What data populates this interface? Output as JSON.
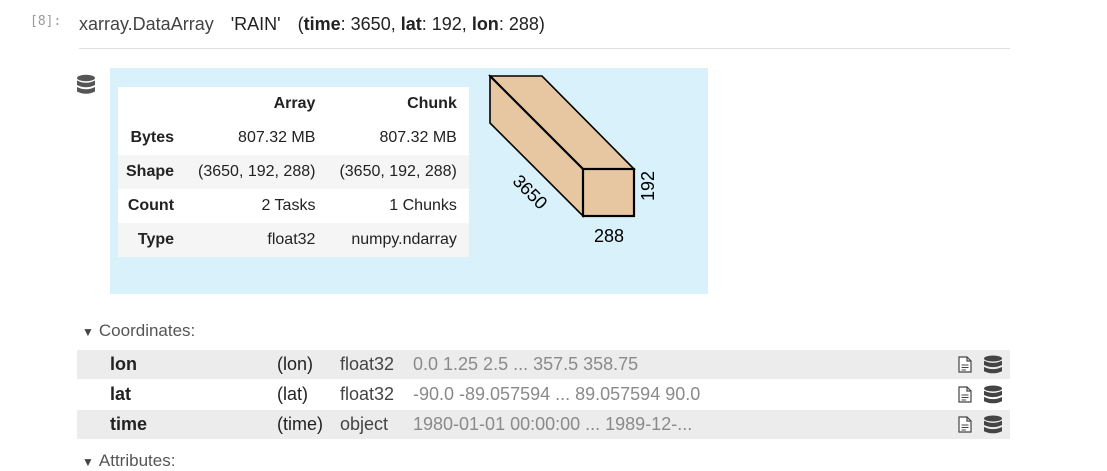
{
  "cell": {
    "prompt": "[8]:"
  },
  "header": {
    "class_name": "xarray.DataArray",
    "var_name": "'RAIN'",
    "dim_open": "(",
    "dims": [
      {
        "name": "time",
        "sep": ": ",
        "size": "3650",
        "trail": ", "
      },
      {
        "name": "lat",
        "sep": ": ",
        "size": "192",
        "trail": ", "
      },
      {
        "name": "lon",
        "sep": ": ",
        "size": "288",
        "trail": ")"
      }
    ]
  },
  "chunk_table": {
    "headers": [
      "",
      "Array",
      "Chunk"
    ],
    "rows": [
      {
        "label": "Bytes",
        "array": "807.32 MB",
        "chunk": "807.32 MB"
      },
      {
        "label": "Shape",
        "array": "(3650, 192, 288)",
        "chunk": "(3650, 192, 288)"
      },
      {
        "label": "Count",
        "array": "2 Tasks",
        "chunk": "1 Chunks"
      },
      {
        "label": "Type",
        "array": "float32",
        "chunk": "numpy.ndarray"
      }
    ]
  },
  "cube": {
    "label_time": "3650",
    "label_lon": "288",
    "label_lat": "192",
    "fill": "#ECB172"
  },
  "sections": {
    "coordinates": "Coordinates:",
    "attributes": "Attributes:",
    "collapse_glyph": "▼"
  },
  "coordinates": [
    {
      "name": "lon",
      "dims": "(lon)",
      "dtype": "float32",
      "preview": "0.0 1.25 2.5 ... 357.5 358.75"
    },
    {
      "name": "lat",
      "dims": "(lat)",
      "dtype": "float32",
      "preview": "-90.0 -89.057594 ... 89.057594 90.0"
    },
    {
      "name": "time",
      "dims": "(time)",
      "dtype": "object",
      "preview": "1980-01-01 00:00:00 ... 1989-12-..."
    }
  ],
  "icons": {
    "database": "database-icon",
    "file": "file-text-icon"
  },
  "colors": {
    "panel_bg": "#d9f1fb",
    "row_shade": "#ececec",
    "cube_fill": "#ECB172"
  }
}
